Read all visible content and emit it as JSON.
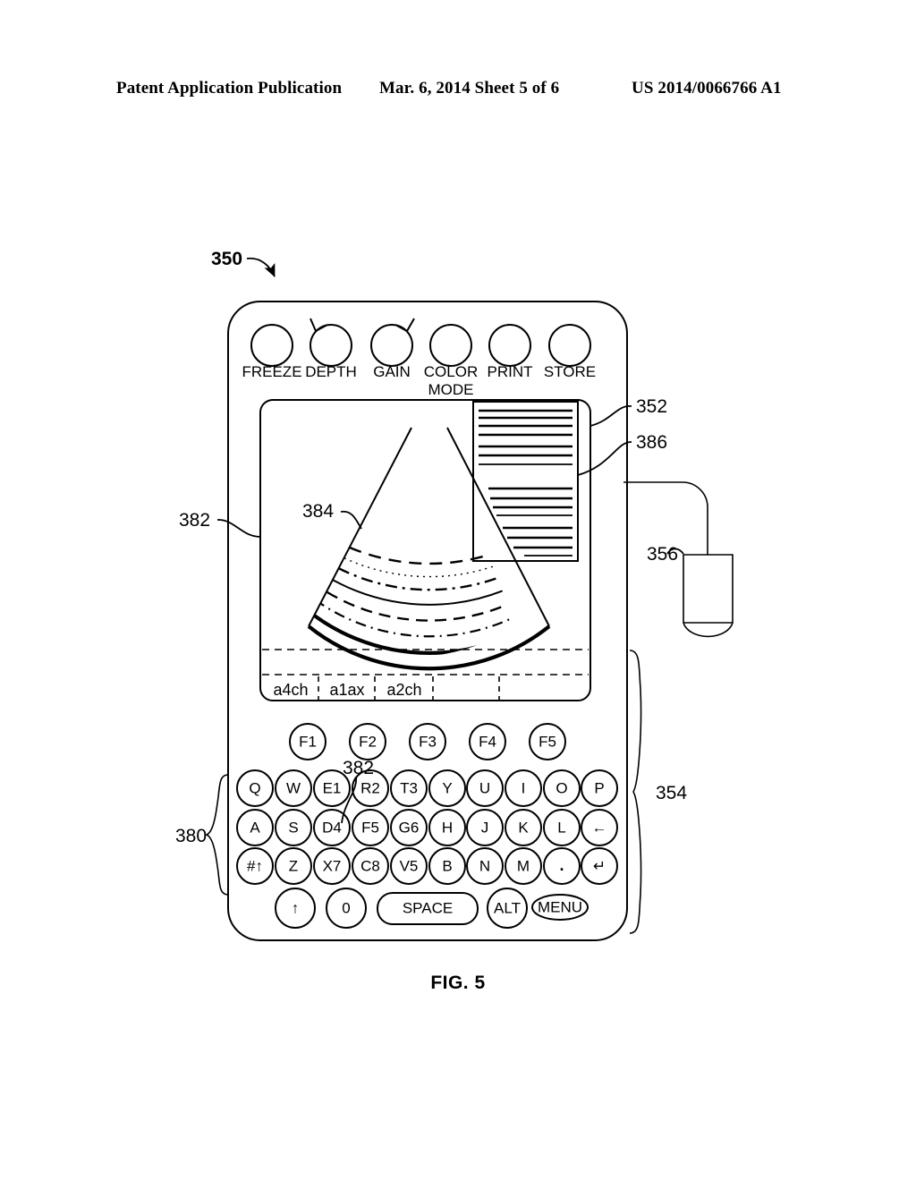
{
  "header": {
    "left": "Patent Application Publication",
    "middle": "Mar. 6, 2014  Sheet 5 of 6",
    "right": "US 2014/0066766 A1"
  },
  "figure": {
    "caption": "FIG. 5",
    "reference_numerals": [
      {
        "id": "350",
        "label": "350",
        "role": "device-overall",
        "bold": true
      },
      {
        "id": "352",
        "label": "352",
        "role": "display-screen"
      },
      {
        "id": "386",
        "label": "386",
        "role": "text-readout-panel"
      },
      {
        "id": "356",
        "label": "356",
        "role": "ultrasound-probe"
      },
      {
        "id": "354",
        "label": "354",
        "role": "keypad-section"
      },
      {
        "id": "380",
        "label": "380",
        "role": "alphanumeric-keys"
      },
      {
        "id": "382",
        "label": "382",
        "role": "display-bezel"
      },
      {
        "id": "382b",
        "label": "382",
        "role": "key-numeric-overlay"
      },
      {
        "id": "384",
        "label": "384",
        "role": "ultrasound-sector-image"
      }
    ]
  },
  "device": {
    "knobs": [
      {
        "name": "freeze",
        "label": "FREEZE",
        "pointer": "none"
      },
      {
        "name": "depth",
        "label": "DEPTH",
        "pointer": "up-left"
      },
      {
        "name": "gain",
        "label": "GAIN",
        "pointer": "up-right"
      },
      {
        "name": "color-mode",
        "label": "COLOR",
        "label2": "MODE",
        "pointer": "none"
      },
      {
        "name": "print",
        "label": "PRINT",
        "pointer": "none"
      },
      {
        "name": "store",
        "label": "STORE",
        "pointer": "none"
      }
    ],
    "screen": {
      "tabs": [
        {
          "label": "a4ch"
        },
        {
          "label": "a1ax"
        },
        {
          "label": "a2ch"
        },
        {
          "label": ""
        },
        {
          "label": ""
        }
      ]
    },
    "keyboard": {
      "function_row": [
        "F1",
        "F2",
        "F3",
        "F4",
        "F5"
      ],
      "row1": [
        "Q",
        "W",
        "E1",
        "R2",
        "T3",
        "Y",
        "U",
        "I",
        "O",
        "P"
      ],
      "row2": [
        "A",
        "S",
        "D4",
        "F5",
        "G6",
        "H",
        "J",
        "K",
        "L",
        "←"
      ],
      "row3": [
        "#↑",
        "Z",
        "X7",
        "C8",
        "V5",
        "B",
        "N",
        "M",
        ".",
        "↵"
      ],
      "row4": [
        {
          "label": "↑",
          "shape": "circle"
        },
        {
          "label": "0",
          "shape": "circle"
        },
        {
          "label": "SPACE",
          "shape": "pill"
        },
        {
          "label": "ALT",
          "shape": "circle"
        },
        {
          "label": "MENU",
          "shape": "ellipse"
        }
      ]
    }
  },
  "colors": {
    "ink": "#000000",
    "paper": "#ffffff"
  }
}
